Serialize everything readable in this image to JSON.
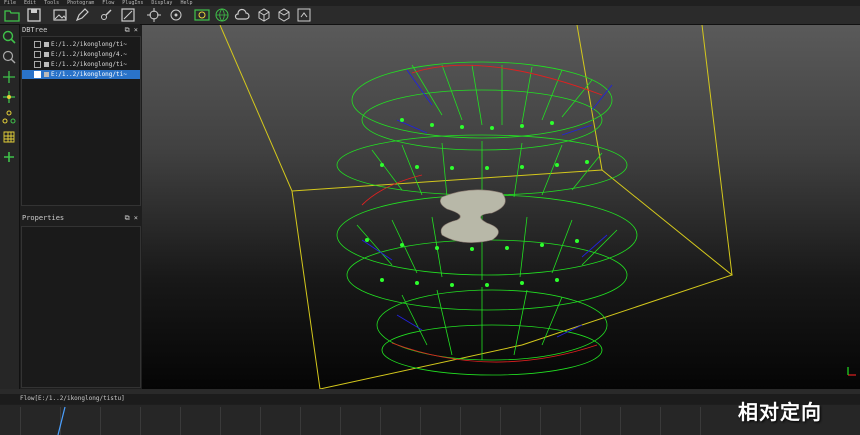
{
  "menu": [
    "File",
    "Edit",
    "Tools",
    "Photogram",
    "Flow",
    "PlugIns",
    "Display",
    "Help"
  ],
  "toolbar_icons": [
    "folder-open-icon",
    "save-icon",
    "image-icon",
    "pen-icon",
    "edit-icon",
    "target-icon",
    "crosshair-icon",
    "camera-group-icon",
    "globe-icon",
    "cloud-icon",
    "cube-add-icon",
    "cube-edit-icon",
    "cube-settings-icon"
  ],
  "left_tools": [
    "search-icon",
    "zoom-icon",
    "pick-point-icon",
    "add-point-icon",
    "nodes-icon",
    "grid-icon",
    "add-icon"
  ],
  "dbtree": {
    "title": "DBTree",
    "items": [
      {
        "label": "E:/1..2/ikonglong/ti~",
        "selected": false
      },
      {
        "label": "E:/1..2/ikonglong/4.~",
        "selected": false
      },
      {
        "label": "E:/1..2/ikonglong/ti~",
        "selected": false
      },
      {
        "label": "E:/1..2/ikonglong/ti~",
        "selected": true
      }
    ]
  },
  "properties": {
    "title": "Properties"
  },
  "panel_buttons": {
    "float": "⧉",
    "close": "×"
  },
  "flow": {
    "path": "Flow[E:/1..2/ikonglong/tistu]"
  },
  "caption": "相对定向"
}
